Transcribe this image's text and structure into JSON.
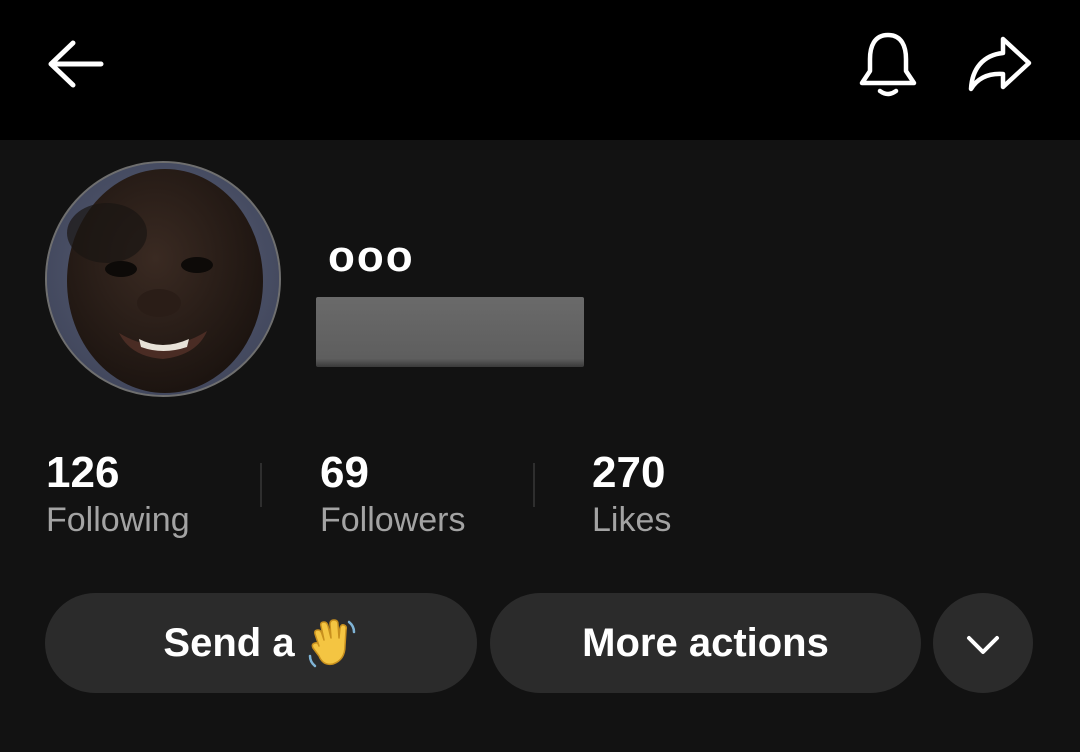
{
  "header": {
    "back_icon": "arrow-left-icon",
    "bell_icon": "bell-icon",
    "share_icon": "share-arrow-icon"
  },
  "profile": {
    "username": "ooo",
    "avatar": "user-avatar-photo"
  },
  "stats": [
    {
      "value": "126",
      "label": "Following"
    },
    {
      "value": "69",
      "label": "Followers"
    },
    {
      "value": "270",
      "label": "Likes"
    }
  ],
  "actions": {
    "send_label": "Send a",
    "send_emoji_icon": "waving-hand-icon",
    "more_label": "More actions",
    "expand_icon": "chevron-down-icon"
  },
  "colors": {
    "topbar_bg": "#000000",
    "page_bg": "#121212",
    "button_bg": "#2b2b2b",
    "secondary_text": "#a3a3a3"
  }
}
